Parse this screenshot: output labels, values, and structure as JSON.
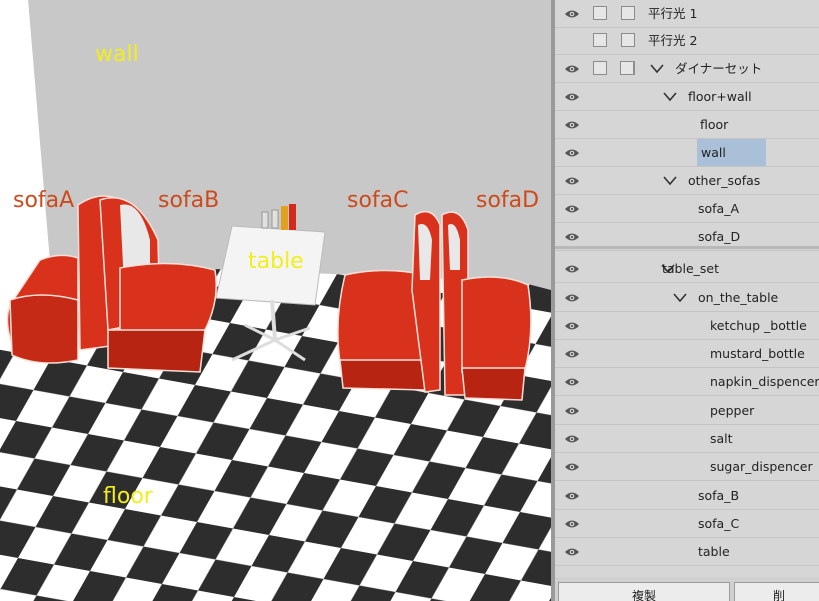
{
  "viewport": {
    "labels": {
      "wall": "wall",
      "sofaA": "sofaA",
      "sofaB": "sofaB",
      "table": "table",
      "sofaC": "sofaC",
      "sofaD": "sofaD",
      "floor": "floor"
    },
    "colors": {
      "wall": "#c8c8c8",
      "floor_dark": "#2d2d2d",
      "floor_light": "#ffffff",
      "sofa_red": "#d8321c",
      "label_yellow": "#f2ee1a",
      "label_red": "#cc4a1c"
    }
  },
  "panel": {
    "rows": [
      {
        "label": "平行光 1",
        "eye": true,
        "checkboxes": 2,
        "chevron": false,
        "selected": false
      },
      {
        "label": "平行光 2",
        "eye": false,
        "checkboxes": 2,
        "chevron": false,
        "selected": false
      },
      {
        "label": "ダイナーセット",
        "eye": true,
        "checkboxes": 3,
        "chevron": true,
        "selected": false
      },
      {
        "label": "floor+wall",
        "eye": true,
        "checkboxes": 0,
        "chevron": true,
        "selected": false
      },
      {
        "label": "floor",
        "eye": true,
        "checkboxes": 0,
        "chevron": false,
        "selected": false
      },
      {
        "label": "wall",
        "eye": true,
        "checkboxes": 0,
        "chevron": false,
        "selected": true
      },
      {
        "label": "other_sofas",
        "eye": true,
        "checkboxes": 0,
        "chevron": true,
        "selected": false
      },
      {
        "label": "sofa_A",
        "eye": true,
        "checkboxes": 0,
        "chevron": false,
        "selected": false
      },
      {
        "label": "sofa_D",
        "eye": true,
        "checkboxes": 0,
        "chevron": false,
        "selected": false
      },
      {
        "label": "table_set",
        "eye": true,
        "checkboxes": 0,
        "chevron": true,
        "selected": false
      },
      {
        "label": "on_the_table",
        "eye": true,
        "checkboxes": 0,
        "chevron": true,
        "selected": false
      },
      {
        "label": "ketchup _bottle",
        "eye": true,
        "checkboxes": 0,
        "chevron": false,
        "selected": false
      },
      {
        "label": "mustard_bottle",
        "eye": true,
        "checkboxes": 0,
        "chevron": false,
        "selected": false
      },
      {
        "label": "napkin_dispencer",
        "eye": true,
        "checkboxes": 0,
        "chevron": false,
        "selected": false
      },
      {
        "label": "pepper",
        "eye": true,
        "checkboxes": 0,
        "chevron": false,
        "selected": false
      },
      {
        "label": "salt",
        "eye": true,
        "checkboxes": 0,
        "chevron": false,
        "selected": false
      },
      {
        "label": "sugar_dispencer",
        "eye": true,
        "checkboxes": 0,
        "chevron": false,
        "selected": false
      },
      {
        "label": "sofa_B",
        "eye": true,
        "checkboxes": 0,
        "chevron": false,
        "selected": false
      },
      {
        "label": "sofa_C",
        "eye": true,
        "checkboxes": 0,
        "chevron": false,
        "selected": false
      },
      {
        "label": "table",
        "eye": true,
        "checkboxes": 0,
        "chevron": false,
        "selected": false
      }
    ],
    "buttons": {
      "duplicate": "複製",
      "delete": "削"
    },
    "colors": {
      "panel_bg": "#d6d6d6",
      "selected_bg": "#a9c0d8"
    }
  }
}
